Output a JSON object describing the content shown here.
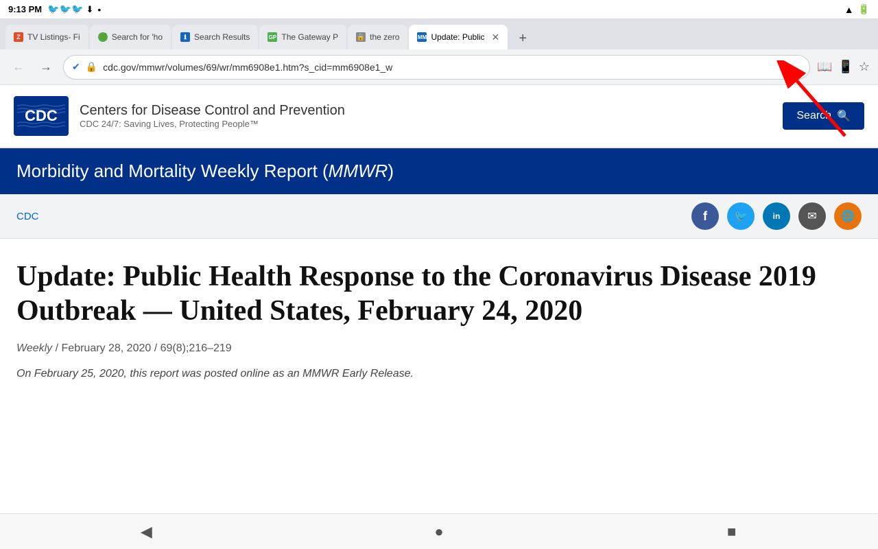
{
  "statusBar": {
    "time": "9:13 PM",
    "icons": [
      "🐦",
      "🐦",
      "🐦",
      "⬇"
    ],
    "rightIcons": [
      "wifi_full",
      "battery_full"
    ]
  },
  "tabs": [
    {
      "id": "tab-tv",
      "favicon": "Z",
      "faviconColor": "#e44d26",
      "label": "TV Listings- Fi",
      "active": false
    },
    {
      "id": "tab-search-how",
      "favicon": "🌿",
      "faviconColor": "#4caf50",
      "label": "Search for 'ho",
      "active": false
    },
    {
      "id": "tab-search-results",
      "favicon": "ℹ",
      "faviconColor": "#1565c0",
      "label": "Search Results",
      "active": false
    },
    {
      "id": "tab-gateway",
      "favicon": "GP",
      "faviconColor": "#4caf50",
      "label": "The Gateway P",
      "active": false
    },
    {
      "id": "tab-zero",
      "favicon": "🔒",
      "faviconColor": "#666",
      "label": "the zero",
      "active": false
    },
    {
      "id": "tab-update",
      "favicon": "MM",
      "faviconColor": "#1565c0",
      "label": "Update: Public",
      "active": true
    }
  ],
  "addressBar": {
    "url": "cdc.gov/mmwr/volumes/69/wr/mm6908e1.htm?s_cid=mm6908e1_w",
    "back_disabled": true,
    "forward_disabled": false
  },
  "cdcHeader": {
    "logoText": "CDC",
    "orgName": "Centers for Disease Control and Prevention",
    "tagline": "CDC 24/7: Saving Lives, Protecting People™",
    "searchButtonLabel": "Search"
  },
  "mmwrBanner": {
    "title": "Morbidity and Mortality Weekly Report (",
    "titleItalic": "MMWR",
    "titleEnd": ")"
  },
  "socialBar": {
    "cdcLinkLabel": "CDC",
    "icons": [
      {
        "type": "facebook",
        "label": "f"
      },
      {
        "type": "twitter",
        "label": "t"
      },
      {
        "type": "linkedin",
        "label": "in"
      },
      {
        "type": "email",
        "label": "✉"
      },
      {
        "type": "rss",
        "label": "🌐"
      }
    ]
  },
  "article": {
    "title": "Update: Public Health Response to the Coronavirus Disease 2019 Outbreak — United States, February 24, 2020",
    "meta": "Weekly / February 28, 2020 / 69(8);216–219",
    "abstract": "On February 25, 2020, this report was posted online as an MMWR Early Release."
  },
  "bottomNav": {
    "back": "◀",
    "home": "●",
    "stop": "■"
  }
}
